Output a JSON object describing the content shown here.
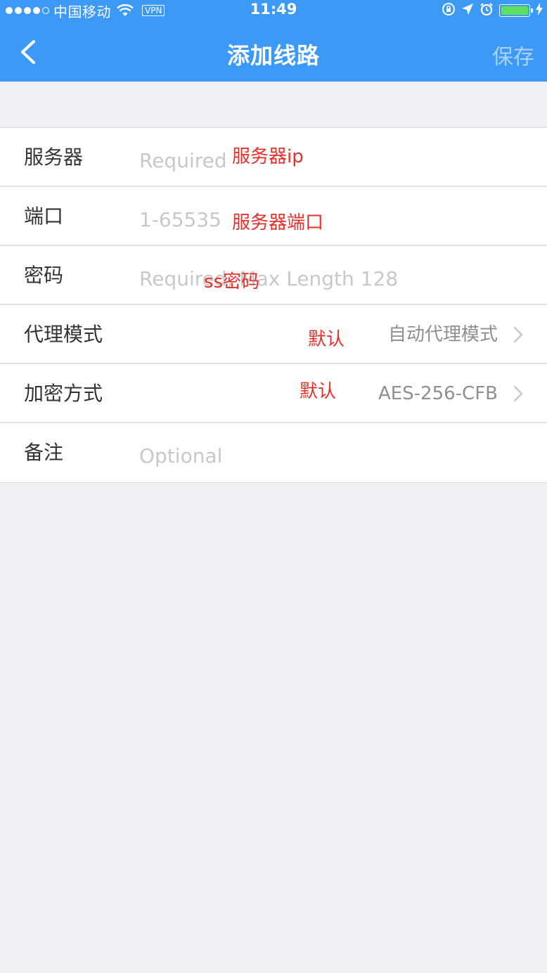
{
  "status_bar": {
    "carrier": "中国移动",
    "vpn": "VPN",
    "time": "11:49",
    "battery_level": 1.0
  },
  "nav": {
    "title": "添加线路",
    "save_label": "保存",
    "back_icon": "chevron-left-icon"
  },
  "form": {
    "rows": [
      {
        "label": "服务器",
        "placeholder": "Required",
        "annotation": "服务器ip"
      },
      {
        "label": "端口",
        "placeholder": "1-65535",
        "annotation": "服务器端口"
      },
      {
        "label": "密码",
        "placeholder": "Required, Max Length 128",
        "annotation": "ss密码"
      },
      {
        "label": "代理模式",
        "value": "自动代理模式",
        "annotation": "默认"
      },
      {
        "label": "加密方式",
        "value": "AES-256-CFB",
        "annotation": "默认"
      },
      {
        "label": "备注",
        "placeholder": "Optional"
      }
    ]
  },
  "colors": {
    "header": "#3d99f6",
    "background": "#efeff4",
    "annotation": "#e8302a"
  }
}
